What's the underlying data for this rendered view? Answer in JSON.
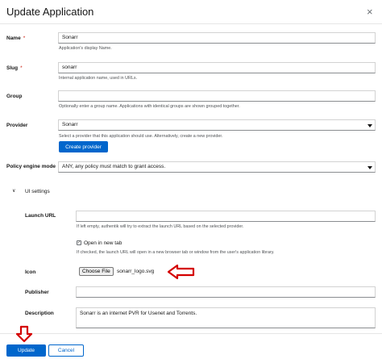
{
  "dialog": {
    "title": "Update Application",
    "close_glyph": "×"
  },
  "fields": {
    "name": {
      "label": "Name",
      "required_mark": "*",
      "value": "Sonarr",
      "helper": "Application's display Name."
    },
    "slug": {
      "label": "Slug",
      "required_mark": "*",
      "value": "sonarr",
      "helper": "Internal application name, used in URLs."
    },
    "group": {
      "label": "Group",
      "value": "",
      "helper": "Optionally enter a group name. Applications with identical groups are shown grouped together."
    },
    "provider": {
      "label": "Provider",
      "value": "Sonarr",
      "helper": "Select a provider that this application should use. Alternatively, create a new provider.",
      "create_button": "Create provider"
    },
    "policy_engine_mode": {
      "label": "Policy engine mode",
      "required_mark": "*",
      "value": "ANY, any policy must match to grant access."
    }
  },
  "ui_settings": {
    "toggle_label": "UI settings",
    "launch_url": {
      "label": "Launch URL",
      "value": "",
      "helper": "If left empty, authentik will try to extract the launch URL based on the selected provider."
    },
    "open_new_tab": {
      "label": "Open in new tab",
      "checked": true,
      "check_glyph": "✓",
      "helper": "If checked, the launch URL will open in a new browser tab or window from the user's application library."
    },
    "icon": {
      "label": "Icon",
      "choose_file_label": "Choose File",
      "file_name": "sonarr_logo.svg"
    },
    "publisher": {
      "label": "Publisher",
      "value": ""
    },
    "description": {
      "label": "Description",
      "value": "Sonarr is an internet PVR for Usenet and Torrents."
    }
  },
  "footer": {
    "update_label": "Update",
    "cancel_label": "Cancel"
  },
  "annotations": {
    "arrow_color": "#d40000"
  },
  "colors": {
    "primary": "#0066cc",
    "required": "#c9190b"
  }
}
